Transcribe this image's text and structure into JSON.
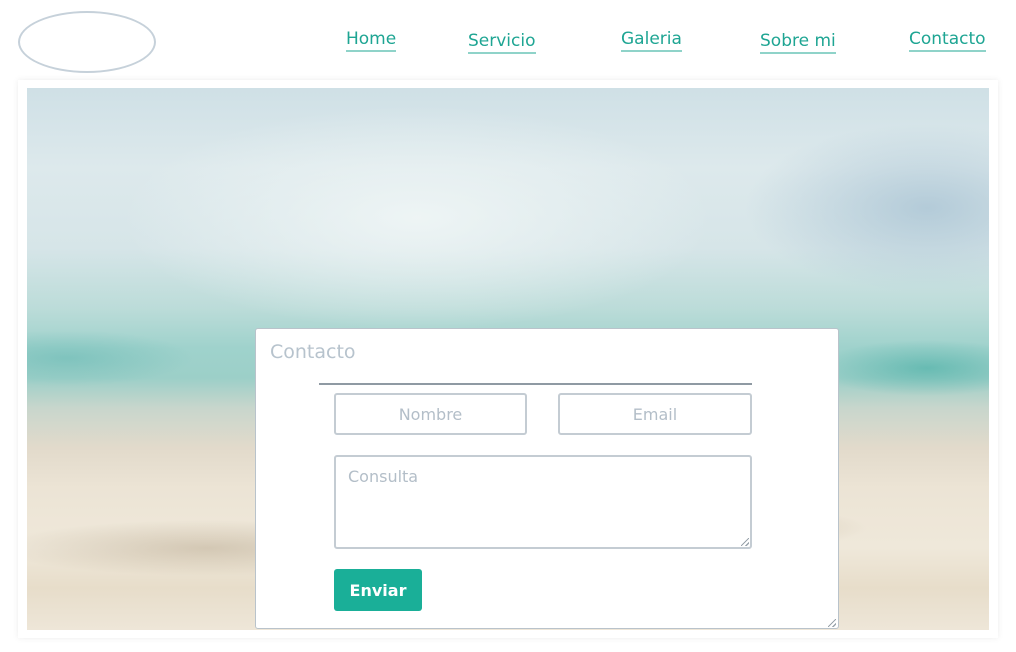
{
  "nav": {
    "items": [
      {
        "label": "Home"
      },
      {
        "label": "Servicio"
      },
      {
        "label": "Galeria"
      },
      {
        "label": "Sobre mi"
      },
      {
        "label": "Contacto"
      }
    ]
  },
  "form": {
    "title": "Contacto",
    "nombre_placeholder": "Nombre",
    "email_placeholder": "Email",
    "consulta_placeholder": "Consulta",
    "submit_label": "Enviar"
  },
  "colors": {
    "accent": "#1aaf98",
    "nav_link": "#1ea593",
    "placeholder": "#b3bec8"
  }
}
